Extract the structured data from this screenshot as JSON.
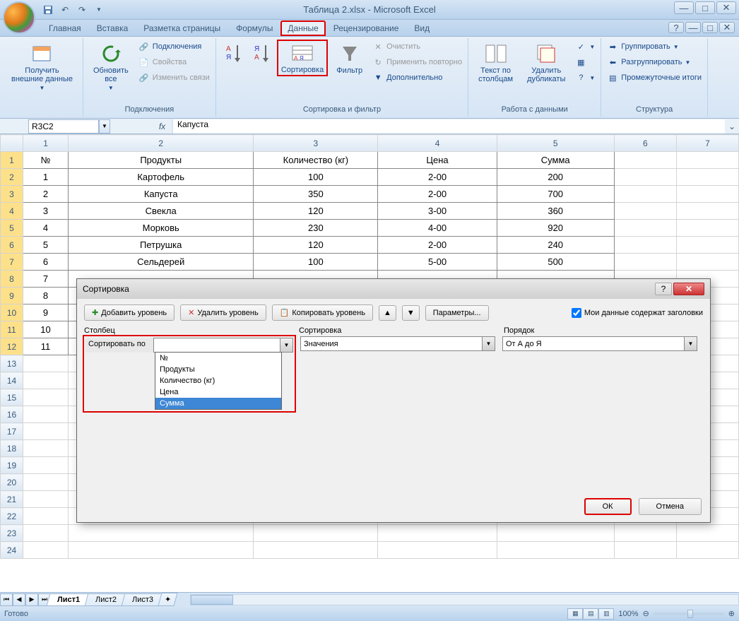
{
  "title": "Таблица 2.xlsx - Microsoft Excel",
  "tabs": [
    "Главная",
    "Вставка",
    "Разметка страницы",
    "Формулы",
    "Данные",
    "Рецензирование",
    "Вид"
  ],
  "active_tab": "Данные",
  "ribbon": {
    "get_data": "Получить\nвнешние данные",
    "refresh": "Обновить\nвсе",
    "connections": "Подключения",
    "properties": "Свойства",
    "edit_links": "Изменить связи",
    "group1_label": "Подключения",
    "sort": "Сортировка",
    "filter": "Фильтр",
    "clear": "Очистить",
    "reapply": "Применить повторно",
    "advanced": "Дополнительно",
    "group2_label": "Сортировка и фильтр",
    "text_cols": "Текст по\nстолбцам",
    "remove_dup": "Удалить\nдубликаты",
    "group3_label": "Работа с данными",
    "group": "Группировать",
    "ungroup": "Разгруппировать",
    "subtotal": "Промежуточные итоги",
    "group4_label": "Структура"
  },
  "name_box": "R3C2",
  "formula": "Капуста",
  "columns": [
    "1",
    "2",
    "3",
    "4",
    "5",
    "6",
    "7"
  ],
  "headers": [
    "№",
    "Продукты",
    "Количество (кг)",
    "Цена",
    "Сумма"
  ],
  "rows": [
    {
      "n": "1",
      "p": "Картофель",
      "q": "100",
      "pr": "2-00",
      "s": "200"
    },
    {
      "n": "2",
      "p": "Капуста",
      "q": "350",
      "pr": "2-00",
      "s": "700"
    },
    {
      "n": "3",
      "p": "Свекла",
      "q": "120",
      "pr": "3-00",
      "s": "360"
    },
    {
      "n": "4",
      "p": "Морковь",
      "q": "230",
      "pr": "4-00",
      "s": "920"
    },
    {
      "n": "5",
      "p": "Петрушка",
      "q": "120",
      "pr": "2-00",
      "s": "240"
    },
    {
      "n": "6",
      "p": "Сельдерей",
      "q": "100",
      "pr": "5-00",
      "s": "500"
    },
    {
      "n": "7",
      "p": "",
      "q": "",
      "pr": "",
      "s": ""
    },
    {
      "n": "8",
      "p": "",
      "q": "",
      "pr": "",
      "s": ""
    },
    {
      "n": "9",
      "p": "",
      "q": "",
      "pr": "",
      "s": ""
    },
    {
      "n": "10",
      "p": "",
      "q": "",
      "pr": "",
      "s": ""
    },
    {
      "n": "11",
      "p": "",
      "q": "",
      "pr": "",
      "s": ""
    }
  ],
  "row_count": 24,
  "sheets": [
    "Лист1",
    "Лист2",
    "Лист3"
  ],
  "status": "Готово",
  "zoom": "100%",
  "dialog": {
    "title": "Сортировка",
    "add_level": "Добавить уровень",
    "delete_level": "Удалить уровень",
    "copy_level": "Копировать уровень",
    "options": "Параметры...",
    "headers_check": "Мои данные содержат заголовки",
    "col_hdr": "Столбец",
    "sort_hdr": "Сортировка",
    "order_hdr": "Порядок",
    "sort_by": "Сортировать по",
    "sort_on_val": "Значения",
    "order_val": "От А до Я",
    "dropdown_items": [
      "№",
      "Продукты",
      "Количество (кг)",
      "Цена",
      "Сумма"
    ],
    "ok": "ОК",
    "cancel": "Отмена"
  }
}
